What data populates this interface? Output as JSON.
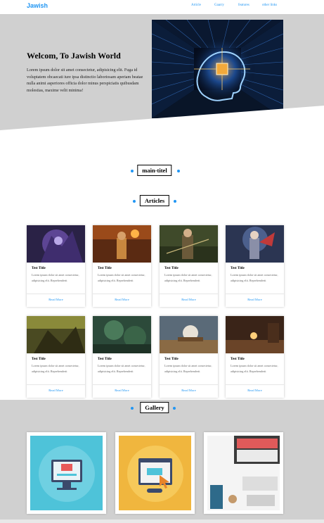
{
  "header": {
    "logo": "Jawish",
    "nav": [
      "Article",
      "Gaarry",
      "features",
      "other links"
    ]
  },
  "hero": {
    "title": "Welcom, To Jawish World",
    "text": "Lorem ipsum dolor sit amet consectetur, adipisicing elit. Fuga id voluptatem obcaecati iure ipsa distinctio laboriosam aperiam beatae nulla animi asperiores officia dolor minus perspiciatis quibusdam molestias, maxime velit minima!"
  },
  "sections": {
    "main": "main-titel",
    "articles": "Articles",
    "gallery": "Gallery"
  },
  "articles": [
    {
      "title": "Test Title",
      "text": "Lorem ipsum dolor sit amet consectetur, adipisicing elit. Reprehenderit",
      "button": "Read More"
    },
    {
      "title": "Test Title",
      "text": "Lorem ipsum dolor sit amet consectetur, adipisicing elit. Reprehenderit",
      "button": "Read More"
    },
    {
      "title": "Test Title",
      "text": "Lorem ipsum dolor sit amet consectetur, adipisicing elit. Reprehenderit",
      "button": "Read More"
    },
    {
      "title": "Test Title",
      "text": "Lorem ipsum dolor sit amet consectetur, adipisicing elit. Reprehenderit",
      "button": "Read More"
    },
    {
      "title": "Test Title",
      "text": "Lorem ipsum dolor sit amet consectetur, adipisicing elit. Reprehenderit",
      "button": "Read More"
    },
    {
      "title": "Test Title",
      "text": "Lorem ipsum dolor sit amet consectetur, adipisicing elit. Reprehenderit",
      "button": "Read More"
    },
    {
      "title": "Test Title",
      "text": "Lorem ipsum dolor sit amet consectetur, adipisicing elit. Reprehenderit",
      "button": "Read More"
    },
    {
      "title": "Test Title",
      "text": "Lorem ipsum dolor sit amet consectetur, adipisicing elit. Reprehenderit",
      "button": "Read More"
    }
  ],
  "colors": {
    "accent": "#2196f3",
    "hero_bg": "#d0d0d0"
  }
}
